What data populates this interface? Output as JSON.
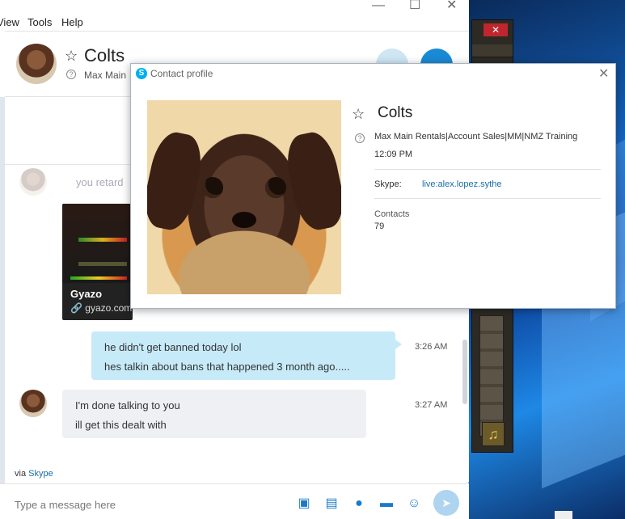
{
  "menu": {
    "items": [
      "View",
      "Tools",
      "Help"
    ]
  },
  "window_controls": [
    "minimize",
    "maximize",
    "close"
  ],
  "header": {
    "contact_name": "Colts",
    "mood": "Max Main Rentals|Account Sales|MM|NMZ Training",
    "video_button": "video-call",
    "call_button": "call"
  },
  "messages": {
    "faded": "you retard",
    "link_card": {
      "title": "Gyazo",
      "domain": "gyazo.com"
    },
    "outgoing": {
      "line1": "he didn't get banned today lol",
      "line2": "hes talkin about bans that happened 3 month ago.....",
      "time": "3:26 AM"
    },
    "incoming": {
      "line1": "I'm done talking to you",
      "line2": "ill get this dealt with",
      "time": "3:27 AM"
    }
  },
  "via": {
    "prefix": "via",
    "link": "Skype"
  },
  "compose": {
    "placeholder": "Type a message here"
  },
  "profile": {
    "title": "Contact profile",
    "name": "Colts",
    "mood": "Max Main Rentals|Account Sales|MM|NMZ Training",
    "local_time": "12:09 PM",
    "skype_label": "Skype:",
    "skype_id": "live:alex.lopez.sythe",
    "contacts_label": "Contacts",
    "contacts_count": "79"
  },
  "background": {
    "close_glyph": "✕"
  }
}
